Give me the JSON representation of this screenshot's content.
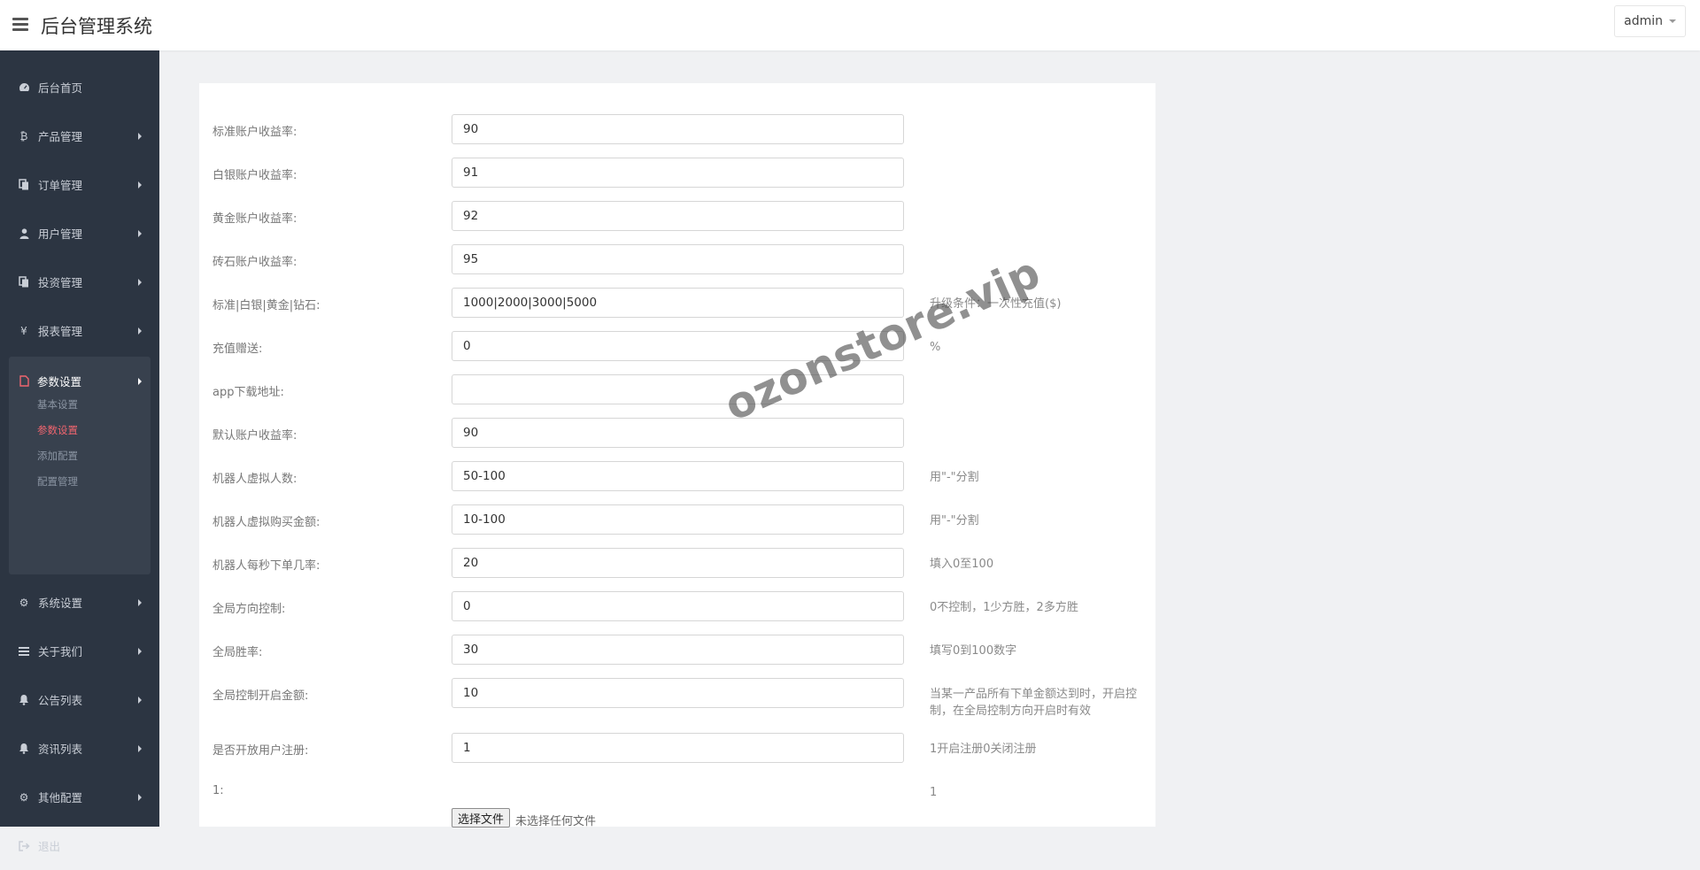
{
  "header": {
    "title": "后台管理系统",
    "user": "admin"
  },
  "sidebar": {
    "items": [
      {
        "label": "后台首页",
        "icon": "dashboard-icon"
      },
      {
        "label": "产品管理",
        "icon": "bitcoin-icon"
      },
      {
        "label": "订单管理",
        "icon": "copy-icon"
      },
      {
        "label": "用户管理",
        "icon": "user-icon"
      },
      {
        "label": "投资管理",
        "icon": "copy-icon"
      },
      {
        "label": "报表管理",
        "icon": "yen-icon"
      },
      {
        "label": "参数设置",
        "icon": "file-icon"
      },
      {
        "label": "系统设置",
        "icon": "cogs-icon"
      },
      {
        "label": "关于我们",
        "icon": "list-icon"
      },
      {
        "label": "公告列表",
        "icon": "bell-icon"
      },
      {
        "label": "资讯列表",
        "icon": "bell-icon"
      },
      {
        "label": "其他配置",
        "icon": "gear-icon"
      },
      {
        "label": "退出",
        "icon": "sign-out-icon"
      }
    ],
    "active_group": "参数设置",
    "sub_items": [
      {
        "label": "基本设置"
      },
      {
        "label": "参数设置",
        "active": true
      },
      {
        "label": "添加配置"
      },
      {
        "label": "配置管理"
      }
    ]
  },
  "form": {
    "rows": [
      {
        "label": "标准账户收益率:",
        "value": "90",
        "help": ""
      },
      {
        "label": "白银账户收益率:",
        "value": "91",
        "help": ""
      },
      {
        "label": "黄金账户收益率:",
        "value": "92",
        "help": ""
      },
      {
        "label": "砖石账户收益率:",
        "value": "95",
        "help": ""
      },
      {
        "label": "标准|白银|黄金|钻石:",
        "value": "1000|2000|3000|5000",
        "help": "升级条件：一次性充值($)"
      },
      {
        "label": "充值赠送:",
        "value": "0",
        "help": "%"
      },
      {
        "label": "app下载地址:",
        "value": "",
        "help": ""
      },
      {
        "label": "默认账户收益率:",
        "value": "90",
        "help": ""
      },
      {
        "label": "机器人虚拟人数:",
        "value": "50-100",
        "help": "用\"-\"分割"
      },
      {
        "label": "机器人虚拟购买金额:",
        "value": "10-100",
        "help": "用\"-\"分割"
      },
      {
        "label": "机器人每秒下单几率:",
        "value": "20",
        "help": "填入0至100"
      },
      {
        "label": "全局方向控制:",
        "value": "0",
        "help": "0不控制，1少方胜，2多方胜"
      },
      {
        "label": "全局胜率:",
        "value": "30",
        "help": "填写0到100数字"
      },
      {
        "label": "全局控制开启金额:",
        "value": "10",
        "help": "当某一产品所有下单金额达到时，开启控制，在全局控制方向开启时有效"
      },
      {
        "label": "是否开放用户注册:",
        "value": "1",
        "help": "1开启注册0关闭注册"
      },
      {
        "label": "1:",
        "value": null,
        "help": "1"
      }
    ],
    "file_button": "选择文件",
    "file_status": "未选择任何文件"
  },
  "watermark": "ozonstore.vip"
}
